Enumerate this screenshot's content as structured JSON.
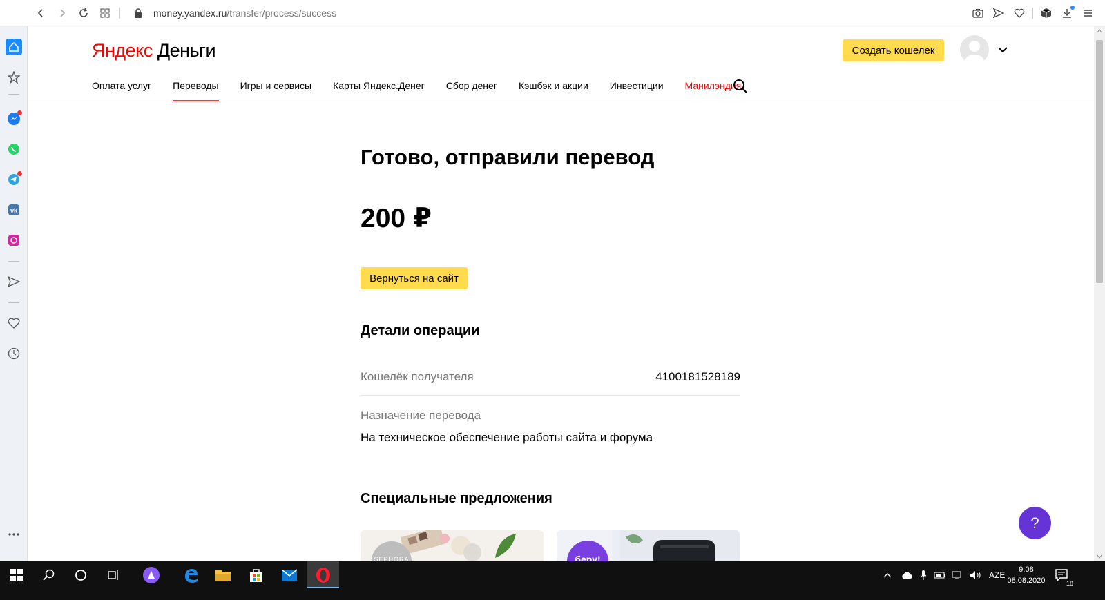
{
  "browser": {
    "url_host": "money.yandex.ru",
    "url_path": "/transfer/process/success"
  },
  "header": {
    "logo_red": "Яндекс",
    "logo_black": "Деньги",
    "create_wallet": "Создать кошелек",
    "menu": [
      {
        "label": "Оплата услуг"
      },
      {
        "label": "Переводы"
      },
      {
        "label": "Игры и сервисы"
      },
      {
        "label": "Карты Яндекс.Денег"
      },
      {
        "label": "Сбор денег"
      },
      {
        "label": "Кэшбэк и акции"
      },
      {
        "label": "Инвестиции"
      },
      {
        "label": "Манилэндия"
      }
    ],
    "active_menu": "Переводы"
  },
  "main": {
    "title": "Готово, отправили перевод",
    "amount": "200 ₽",
    "back_button": "Вернуться на сайт",
    "details_title": "Детали операции",
    "recipient_label": "Кошелёк получателя",
    "recipient_value": "4100181528189",
    "purpose_label": "Назначение перевода",
    "purpose_value": "На техническое обеспечение работы сайта и форума",
    "special_title": "Специальные предложения",
    "offer1_text": "SEPHORA",
    "offer2_text": "беру!"
  },
  "help": {
    "label": "?"
  },
  "taskbar": {
    "lang": "AZE",
    "time": "9:08",
    "date": "08.08.2020",
    "notifications": "18"
  },
  "colors": {
    "accent_yellow": "#ffdb4d",
    "brand_red": "#ff0000",
    "help_purple": "#6533d6"
  }
}
